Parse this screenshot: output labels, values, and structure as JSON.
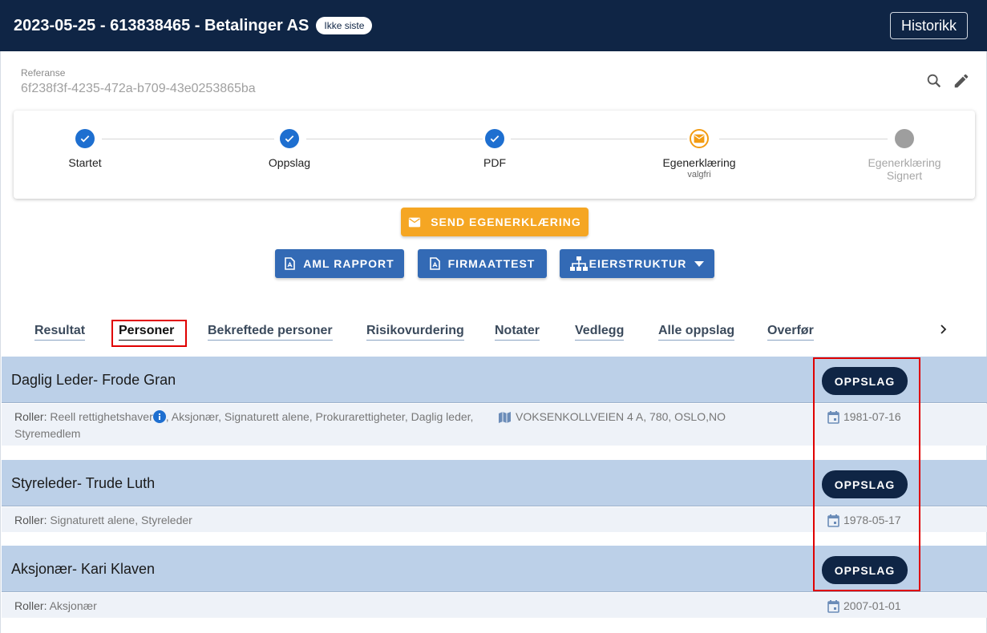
{
  "header": {
    "title": "2023-05-25 - 613838465 - Betalinger AS",
    "badge": "Ikke siste",
    "history_label": "Historikk"
  },
  "reference": {
    "label": "Referanse",
    "value": "6f238f3f-4235-472a-b709-43e0253865ba"
  },
  "icons": {
    "search": "search-icon",
    "edit": "pencil-icon"
  },
  "stepper": {
    "steps": [
      {
        "label": "Startet",
        "sub": "",
        "state": "done"
      },
      {
        "label": "Oppslag",
        "sub": "",
        "state": "done"
      },
      {
        "label": "PDF",
        "sub": "",
        "state": "done"
      },
      {
        "label": "Egenerklæring",
        "sub": "valgfri",
        "state": "active"
      },
      {
        "label": "Egenerklæring",
        "sub": "Signert",
        "state": "pending"
      }
    ]
  },
  "actions": {
    "send_label": "SEND EGENERKLÆRING",
    "aml_label": "AML RAPPORT",
    "firmaattest_label": "FIRMAATTEST",
    "eierstruktur_label": "EIERSTRUKTUR"
  },
  "tabs": [
    "Resultat",
    "Personer",
    "Bekreftede personer",
    "Risikovurdering",
    "Notater",
    "Vedlegg",
    "Alle oppslag",
    "Overfør"
  ],
  "selected_tab": "Personer",
  "persons": [
    {
      "name": "Daglig Leder- Frode Gran",
      "button": "OPPSLAG",
      "roles_key": "Roller:",
      "roles_before": "Reell rettighetshaver",
      "roles_after": ", Aksjonær, Signaturett alene, Prokurarettigheter, Daglig leder, Styremedlem",
      "address": "VOKSENKOLLVEIEN 4 A, 780, OSLO,NO",
      "dob": "1981-07-16"
    },
    {
      "name": "Styreleder- Trude Luth",
      "button": "OPPSLAG",
      "roles_key": "Roller:",
      "roles_before": "Signaturett alene, Styreleder",
      "roles_after": "",
      "address": "",
      "dob": "1978-05-17"
    },
    {
      "name": "Aksjonær- Kari Klaven",
      "button": "OPPSLAG",
      "roles_key": "Roller:",
      "roles_before": "Aksjonær",
      "roles_after": "",
      "address": "",
      "dob": "2007-01-01"
    }
  ],
  "colors": {
    "header_bg": "#0f2545",
    "step_done": "#1e6fd0",
    "step_active": "#f39c12",
    "send_button": "#f5a623",
    "action_button": "#336ab5",
    "person_header_bg": "#bcd0e8",
    "highlight": "#e00000"
  }
}
